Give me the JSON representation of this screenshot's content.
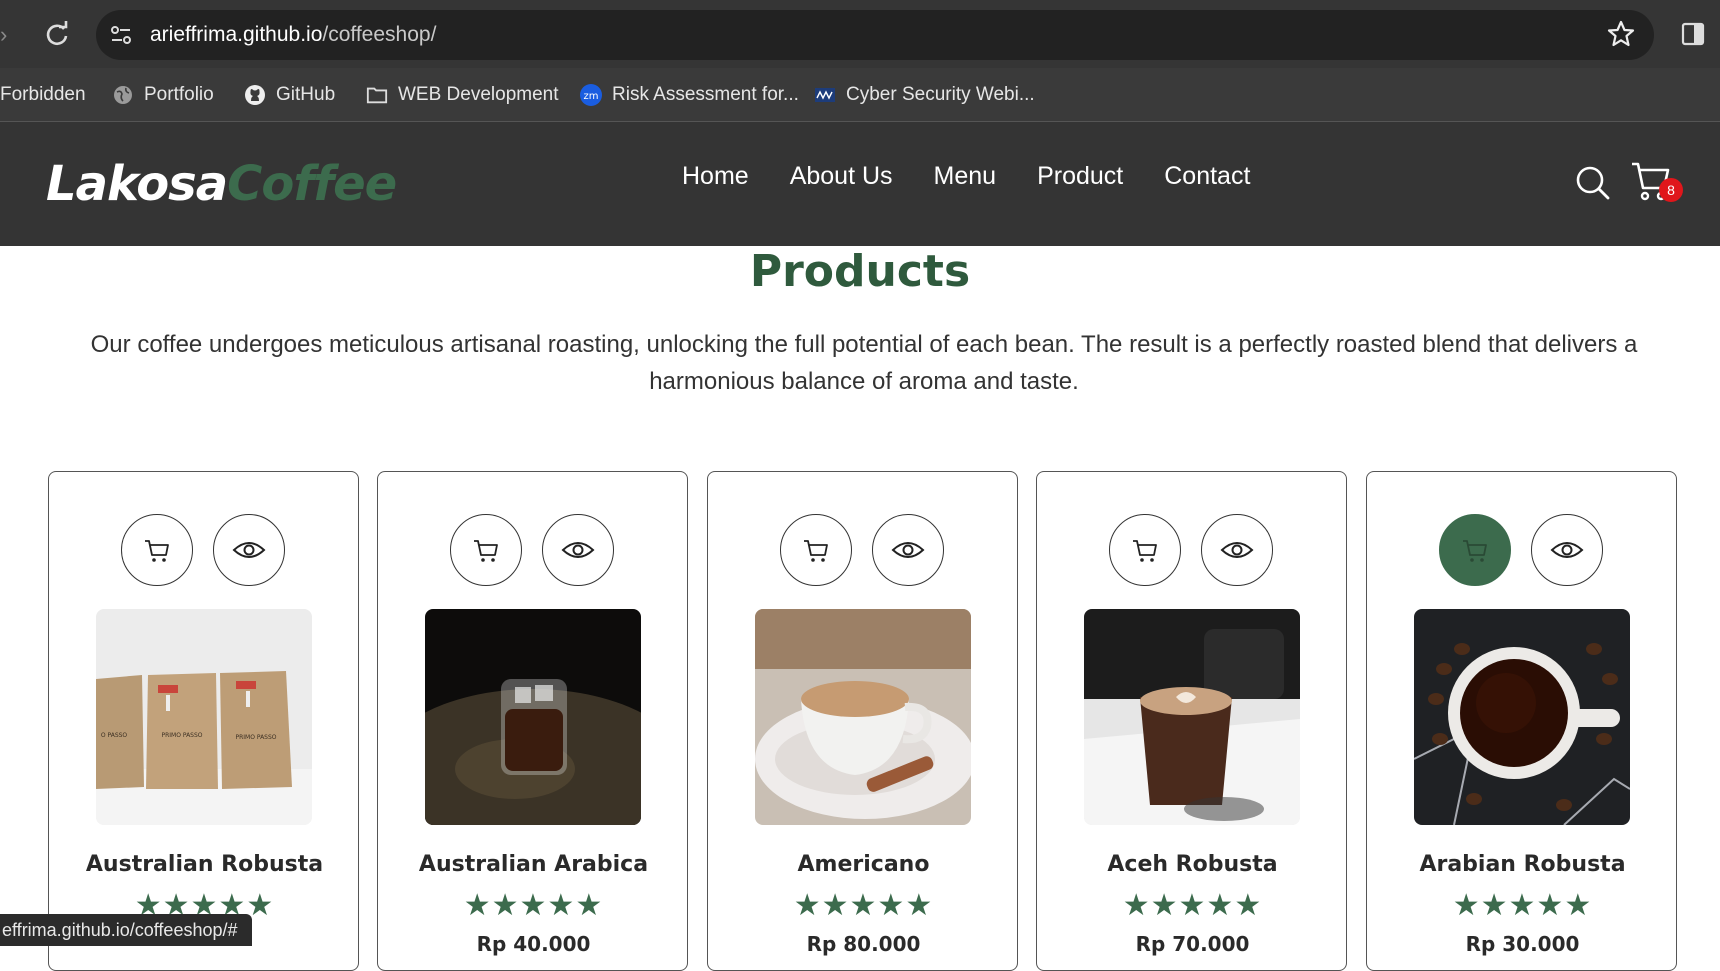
{
  "browser": {
    "url_host": "arieffrima.github.io",
    "url_path": "/coffeeshop/",
    "bookmarks": [
      {
        "label": "Forbidden",
        "icon": "none"
      },
      {
        "label": "Portfolio",
        "icon": "globe-icon"
      },
      {
        "label": "GitHub",
        "icon": "github-icon"
      },
      {
        "label": "WEB Development",
        "icon": "folder-icon"
      },
      {
        "label": "Risk Assessment for...",
        "icon": "zm-icon"
      },
      {
        "label": "Cyber Security Webi...",
        "icon": "sans-icon"
      }
    ],
    "status_url": "effrima.github.io/coffeeshop/#"
  },
  "site": {
    "logo_main": "Lakosa",
    "logo_accent": "Coffee",
    "nav": [
      "Home",
      "About Us",
      "Menu",
      "Product",
      "Contact"
    ],
    "cart_count": "8",
    "colors": {
      "accent": "#3c6b4d",
      "nav_bg": "#343434",
      "badge": "#e0161b"
    }
  },
  "products_section": {
    "title": "Products",
    "description": "Our coffee undergoes meticulous artisanal roasting, unlocking the full potential of each bean. The result is a perfectly roasted blend that delivers a harmonious balance of aroma and taste.",
    "items": [
      {
        "name": "Australian Robusta",
        "stars": "★★★★★",
        "price": ""
      },
      {
        "name": "Australian Arabica",
        "stars": "★★★★★",
        "price": "Rp 40.000"
      },
      {
        "name": "Americano",
        "stars": "★★★★★",
        "price": "Rp 80.000"
      },
      {
        "name": "Aceh Robusta",
        "stars": "★★★★★",
        "price": "Rp 70.000"
      },
      {
        "name": "Arabian Robusta",
        "stars": "★★★★★",
        "price": "Rp 30.000"
      }
    ]
  }
}
